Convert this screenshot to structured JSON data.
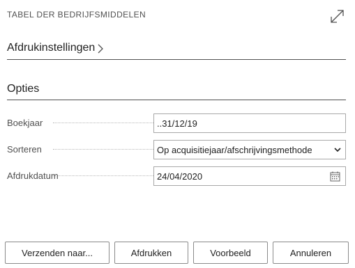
{
  "header": {
    "title": "TABEL DER BEDRIJFSMIDDELEN",
    "expand_icon": "expand-arrows-icon"
  },
  "print_settings": {
    "label": "Afdrukinstellingen",
    "chevron_icon": "chevron-right-icon"
  },
  "options": {
    "label": "Opties",
    "fields": [
      {
        "label": "Boekjaar",
        "value": "..31/12/19"
      },
      {
        "label": "Sorteren",
        "value": "Op acquisitiejaar/afschrijvingsmethode",
        "icon": "chevron-down-icon"
      },
      {
        "label": "Afdrukdatum",
        "value": "24/04/2020",
        "icon": "calendar-icon"
      }
    ]
  },
  "buttons": {
    "send_to": "Verzenden naar...",
    "print": "Afdrukken",
    "preview": "Voorbeeld",
    "cancel": "Annuleren"
  }
}
